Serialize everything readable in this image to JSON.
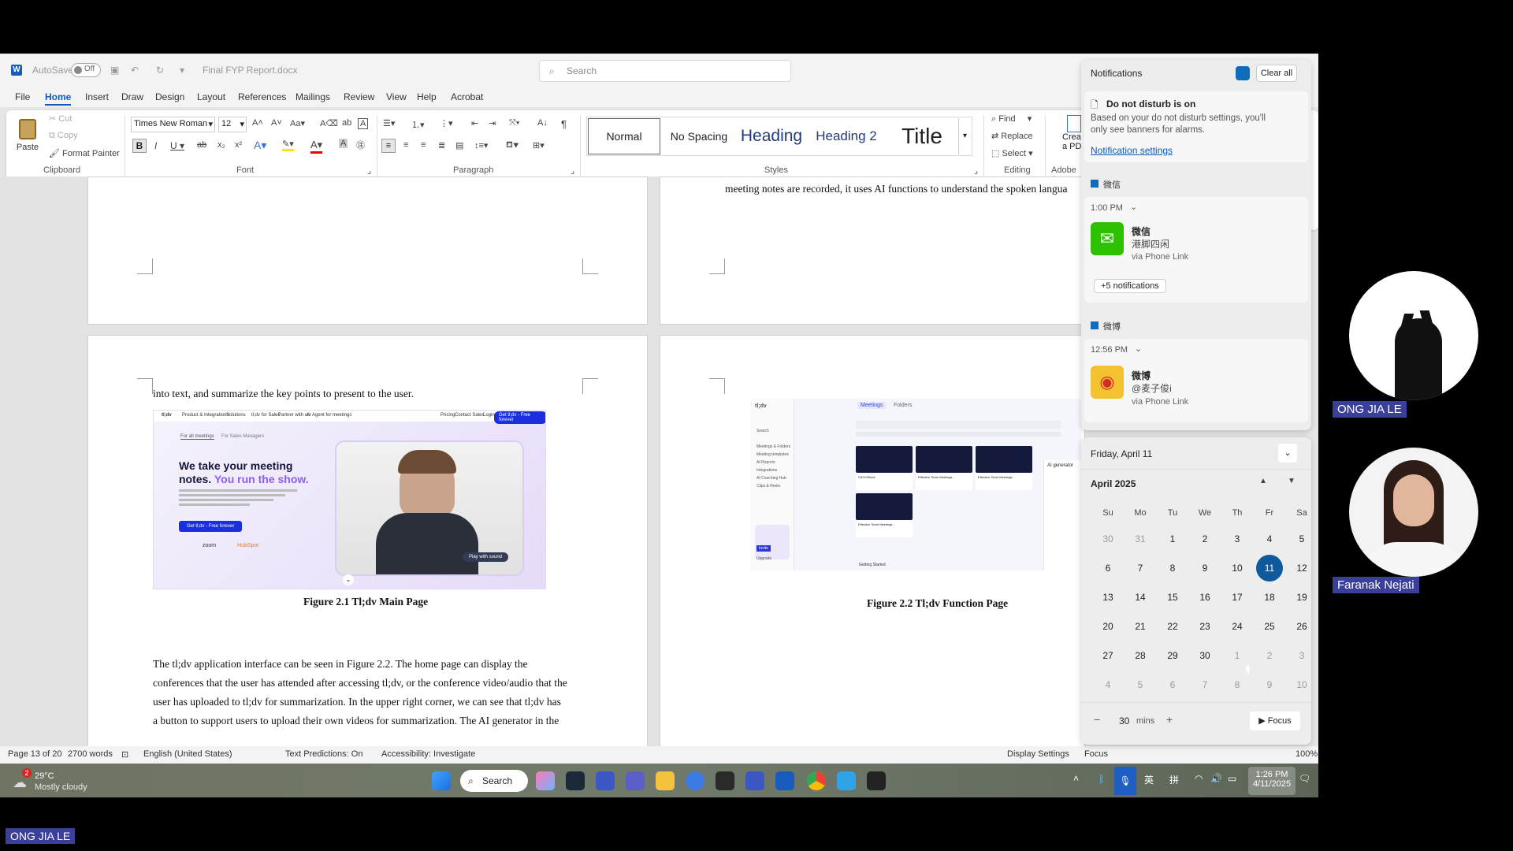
{
  "titlebar": {
    "autosave_label": "AutoSave",
    "autosave_state": "Off",
    "doc_title": "Final FYP Report.docx",
    "search_placeholder": "Search"
  },
  "menu": [
    "File",
    "Home",
    "Insert",
    "Draw",
    "Design",
    "Layout",
    "References",
    "Mailings",
    "Review",
    "View",
    "Help",
    "Acrobat"
  ],
  "menu_active": "Home",
  "ribbon": {
    "clipboard": {
      "paste": "Paste",
      "cut": "Cut",
      "copy": "Copy",
      "format_painter": "Format Painter",
      "label": "Clipboard"
    },
    "font": {
      "name": "Times New Roman",
      "size": "12",
      "label": "Font"
    },
    "paragraph": {
      "label": "Paragraph"
    },
    "styles": {
      "items": [
        "Normal",
        "No Spacing",
        "Heading",
        "Heading 2",
        "Title"
      ],
      "label": "Styles"
    },
    "editing": {
      "find": "Find",
      "replace": "Replace",
      "select": "Select",
      "label": "Editing"
    },
    "adobe": {
      "line1": "Crea",
      "line2": "a PD",
      "label": "Adobe A"
    }
  },
  "document": {
    "page_top_right_text": "meeting notes are recorded, it uses AI functions to understand the spoken langua",
    "page3_first_line": "into text, and summarize the key points to present to the user.",
    "fig1": {
      "caption": "Figure 2.1 Tl;dv Main Page",
      "headline1": "We take your meeting",
      "headline2": "notes.",
      "headline3": "You run the show.",
      "cta": "Get tl;dv - Free forever",
      "play": "Play with sound",
      "nav_items": [
        "tl;dv",
        "Product & Integrations",
        "Solutions",
        "tl;dv for Sales",
        "Partner with us",
        "AI Agent for meetings"
      ],
      "nav_right": [
        "Pricing",
        "Contact Sales",
        "Login"
      ],
      "nav_cta": "Get tl;dv - Free forever",
      "tabs": [
        "For all meetings",
        "For Sales Managers"
      ],
      "integrations": [
        "zoom",
        "HubSpot"
      ]
    },
    "fig2": {
      "caption": "Figure 2.2 Tl;dv Function Page",
      "tabs": [
        "Meetings",
        "Folders"
      ],
      "sidebar": [
        "Search",
        "Meetings & Folders",
        "Meeting templates",
        "AI Reports",
        "Integrations",
        "AI Coaching Hub",
        "Clips & Reels",
        "Invite",
        "Upgrade"
      ],
      "cards": [
        "SSOOStack",
        "Effective Team Meetings -",
        "Effective Team Meetings -",
        "Effective Team Meetings -"
      ],
      "ai_generator": "AI generator",
      "getting_started": "Getting Started"
    },
    "paragraph": [
      "The tl;dv application interface can be seen in Figure 2.2. The home page can display the",
      "conferences that the user has attended after accessing tl;dv, or the conference video/audio that the",
      "user has uploaded to tl;dv for summarization. In the upper right corner, we can see that tl;dv has",
      "a button to support users to upload their own videos for summarization. The AI generator in the"
    ]
  },
  "statusbar": {
    "page": "Page 13 of 20",
    "words": "2700 words",
    "language": "English (United States)",
    "predictions": "Text Predictions: On",
    "accessibility": "Accessibility: Investigate",
    "display": "Display Settings",
    "focus": "Focus",
    "zoom": "100%"
  },
  "taskbar": {
    "weather_temp": "29°C",
    "weather_desc": "Mostly cloudy",
    "weather_badge": "2",
    "search": "Search",
    "time": "1:26 PM",
    "date": "4/11/2025",
    "ime1": "英",
    "ime2": "拼"
  },
  "notifications": {
    "title": "Notifications",
    "clear_all": "Clear all",
    "dnd_title": "Do not disturb is on",
    "dnd_body_1": "Based on your do not disturb settings, you'll",
    "dnd_body_2": "only see banners for alarms.",
    "settings_link": "Notification settings",
    "app1": "微信",
    "app1_time": "1:00 PM",
    "app1_msg_title": "微信",
    "app1_msg_body": "港脚四闲",
    "app1_via": "via Phone Link",
    "more": "+5 notifications",
    "app2": "微博",
    "app2_time": "12:56 PM",
    "app2_msg_title": "微博",
    "app2_msg_body": "@麦子俊i",
    "app2_via": "via Phone Link"
  },
  "calendar": {
    "date_header": "Friday, April 11",
    "month": "April 2025",
    "weekdays": [
      "Su",
      "Mo",
      "Tu",
      "We",
      "Th",
      "Fr",
      "Sa"
    ],
    "weeks": [
      [
        "30",
        "31",
        "1",
        "2",
        "3",
        "4",
        "5"
      ],
      [
        "6",
        "7",
        "8",
        "9",
        "10",
        "11",
        "12"
      ],
      [
        "13",
        "14",
        "15",
        "16",
        "17",
        "18",
        "19"
      ],
      [
        "20",
        "21",
        "22",
        "23",
        "24",
        "25",
        "26"
      ],
      [
        "27",
        "28",
        "29",
        "30",
        "1",
        "2",
        "3"
      ],
      [
        "4",
        "5",
        "6",
        "7",
        "8",
        "9",
        "10"
      ]
    ],
    "today": "11",
    "focus_minutes": "30",
    "focus_unit": "mins",
    "focus_button": "Focus"
  },
  "participants": [
    "ONG JIA LE",
    "Faranak Nejati"
  ],
  "self_label": "ONG JIA LE",
  "colors": {
    "accent": "#185abd",
    "calendar_today": "#0f5a9c",
    "name_tag": "#3a3f9a"
  }
}
